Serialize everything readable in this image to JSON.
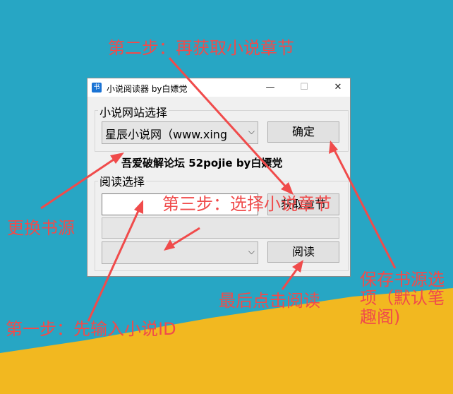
{
  "window": {
    "title": "小说阅读器   by白嫖党",
    "app_icon": "书",
    "minimize": "—",
    "maximize": "☐",
    "close": "✕"
  },
  "site_group": {
    "label": "小说网站选择",
    "selected_site": "星辰小说网（www.xing",
    "confirm_button": "确定"
  },
  "banner": "吾爱破解论坛 52pojie by白嫖党",
  "read_group": {
    "label": "阅读选择",
    "novel_id_value": "",
    "get_chapters_button": "获取章节",
    "chapter_selected": "",
    "read_button": "阅读"
  },
  "annotations": {
    "step2": "第二步：再获取小说章节",
    "change_source": "更换书源",
    "step3": "第三步：选择小说章节",
    "save_source": "保存书源选项（默认笔趣阁)",
    "last_read": "最后点击阅读",
    "step1": "第一步：先输入小说ID"
  },
  "colors": {
    "sky": "#27a6c4",
    "sand": "#f2b820",
    "annotation": "#f04b4b"
  }
}
